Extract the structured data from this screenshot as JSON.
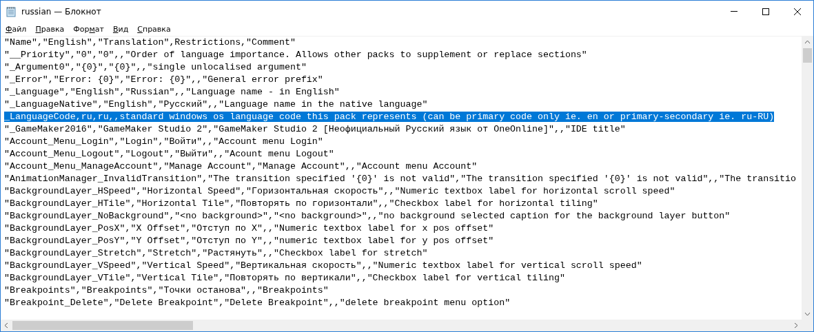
{
  "window": {
    "title": "russian — Блокнот"
  },
  "menu": [
    {
      "key": "Ф",
      "post": "айл"
    },
    {
      "key": "П",
      "post": "равка"
    },
    {
      "pre": "Фор",
      "key": "м",
      "post": "ат"
    },
    {
      "key": "В",
      "post": "ид"
    },
    {
      "key": "С",
      "post": "правка"
    }
  ],
  "lines": [
    {
      "text": "\"Name\",\"English\",\"Translation\",Restrictions,\"Comment\"",
      "selected": false
    },
    {
      "text": "\"__Priority\",\"0\",\"0\",,\"Order of language importance. Allows other packs to supplement or replace sections\"",
      "selected": false
    },
    {
      "text": "\"_Argument0\",\"{0}\",\"{0}\",,\"single unlocalised argument\"",
      "selected": false
    },
    {
      "text": "\"_Error\",\"Error: {0}\",\"Error: {0}\",,\"General error prefix\"",
      "selected": false
    },
    {
      "text": "\"_Language\",\"English\",\"Russian\",,\"Language name - in English\"",
      "selected": false
    },
    {
      "text": "\"_LanguageNative\",\"English\",\"Русский\",,\"Language name in the native language\"",
      "selected": false
    },
    {
      "text": "_LanguageCode,ru,ru,,standard windows os language code this pack represents (can be primary code only ie. en or primary-secondary ie. ru-RU)",
      "selected": true
    },
    {
      "text": "\"_GameMaker2016\",\"GameMaker Studio 2\",\"GameMaker Studio 2 [Неофициальный Русский язык от OneOnline]\",,\"IDE title\"",
      "selected": false
    },
    {
      "text": "\"Account_Menu_Login\",\"Login\",\"Войти\",,\"Account menu Login\"",
      "selected": false
    },
    {
      "text": "\"Account_Menu_Logout\",\"Logout\",\"Выйти\",,\"Acount menu Logout\"",
      "selected": false
    },
    {
      "text": "\"Account_Menu_ManageAccount\",\"Manage Account\",\"Manage Account\",,\"Account menu Account\"",
      "selected": false
    },
    {
      "text": "\"AnimationManager_InvalidTransition\",\"The transition specified '{0}' is not valid\",\"The transition specified '{0}' is not valid\",,\"The transitio",
      "selected": false
    },
    {
      "text": "\"BackgroundLayer_HSpeed\",\"Horizontal Speed\",\"Горизонтальная скорость\",,\"Numeric textbox label for horizontal scroll speed\"",
      "selected": false
    },
    {
      "text": "\"BackgroundLayer_HTile\",\"Horizontal Tile\",\"Повторять по горизонтали\",,\"Checkbox label for horizontal tiling\"",
      "selected": false
    },
    {
      "text": "\"BackgroundLayer_NoBackground\",\"<no background>\",\"<no background>\",,\"no background selected caption for the background layer button\"",
      "selected": false
    },
    {
      "text": "\"BackgroundLayer_PosX\",\"X Offset\",\"Отступ по X\",,\"Numeric textbox label for x pos offset\"",
      "selected": false
    },
    {
      "text": "\"BackgroundLayer_PosY\",\"Y Offset\",\"Отступ по Y\",,\"numeric textbox label for y pos offset\"",
      "selected": false
    },
    {
      "text": "\"BackgroundLayer_Stretch\",\"Stretch\",\"Растянуть\",,\"Checkbox label for stretch\"",
      "selected": false
    },
    {
      "text": "\"BackgroundLayer_VSpeed\",\"Vertical Speed\",\"Вертикальная скорость\",,\"Numeric textbox label for vertical scroll speed\"",
      "selected": false
    },
    {
      "text": "\"BackgroundLayer_VTile\",\"Vertical Tile\",\"Повторять по вертикали\",,\"Checkbox label for vertical tiling\"",
      "selected": false
    },
    {
      "text": "\"Breakpoints\",\"Breakpoints\",\"Точки останова\",,\"Breakpoints\"",
      "selected": false
    },
    {
      "text": "\"Breakpoint_Delete\",\"Delete Breakpoint\",\"Delete Breakpoint\",,\"delete breakpoint menu option\"",
      "selected": false
    }
  ]
}
